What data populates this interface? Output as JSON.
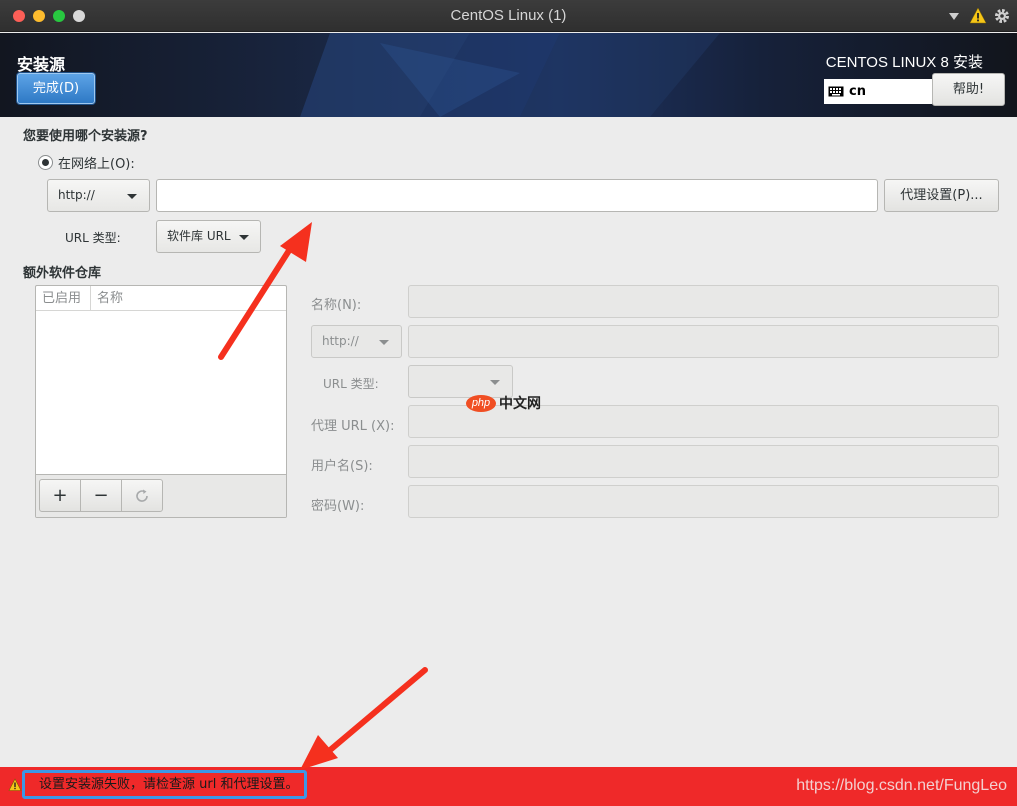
{
  "window": {
    "title": "CentOS Linux (1)"
  },
  "header": {
    "title": "安装源",
    "done_label": "完成(D)",
    "product": "CENTOS LINUX 8 安装",
    "keyboard_layout": "cn",
    "help_label": "帮助!"
  },
  "source": {
    "question": "您要使用哪个安装源?",
    "network_option": "在网络上(O):",
    "protocol": "http://",
    "url_value": "",
    "proxy_label": "代理设置(P)...",
    "url_type_label": "URL 类型:",
    "url_type_value": "软件库 URL"
  },
  "repos": {
    "section_title": "额外软件仓库",
    "col_enabled": "已启用",
    "col_name": "名称",
    "add_label": "+",
    "remove_label": "−",
    "name_label": "名称(N):",
    "protocol": "http://",
    "url_type_label": "URL 类型:",
    "proxy_url_label": "代理 URL (X):",
    "username_label": "用户名(S):",
    "password_label": "密码(W):"
  },
  "watermark": {
    "badge": "php",
    "text": "中文网"
  },
  "status": {
    "error": "设置安装源失败，请检查源 url 和代理设置。",
    "credit": "https://blog.csdn.net/FungLeo"
  },
  "colors": {
    "accent_blue": "#3c97e6",
    "error_red": "#ef2929",
    "annotation_arrow": "#f5301e"
  }
}
